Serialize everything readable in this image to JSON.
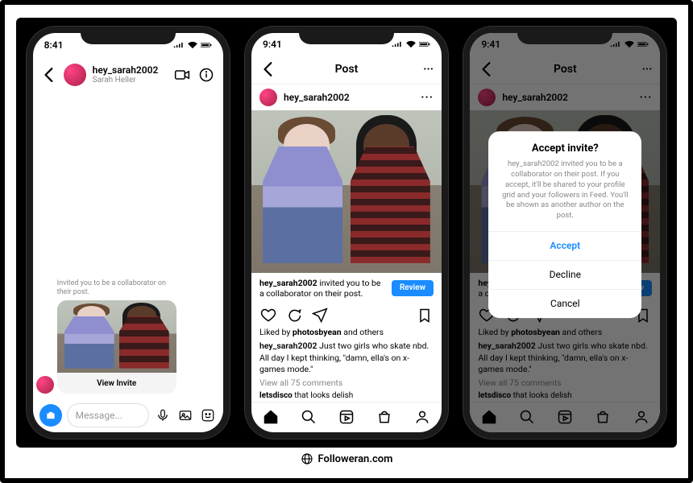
{
  "footer": {
    "site": "Followeran.com"
  },
  "phone1": {
    "time": "8:41",
    "username": "hey_sarah2002",
    "realname": "Sarah Heller",
    "invite_caption": "Invited you to be a collaborator on their post.",
    "view_invite": "View Invite",
    "compose_placeholder": "Message..."
  },
  "phone2": {
    "time": "9:41",
    "title": "Post",
    "author": "hey_sarah2002",
    "banner_user": "hey_sarah2002",
    "banner_rest": " invited you to be a collaborator on their post.",
    "review": "Review",
    "likes_prefix": "Liked by ",
    "likes_bold": "photosbyean",
    "likes_suffix": " and others",
    "caption_user": "hey_sarah2002",
    "caption_text": " Just two girls who skate nbd. All day I kept thinking, \"damn, ella's on x-games mode.\"",
    "viewall": "View all 75 comments",
    "comment_user": "letsdisco",
    "comment_text": " that looks delish"
  },
  "phone3": {
    "time": "9:41",
    "title": "Post",
    "modal_title": "Accept invite?",
    "modal_body": "hey_sarah2002 invited you to be a collaborator on their post. If you accept, it'll be shared to your profile grid and your followers in Feed. You'll be shown as another author on the post.",
    "accept": "Accept",
    "decline": "Decline",
    "cancel": "Cancel"
  }
}
